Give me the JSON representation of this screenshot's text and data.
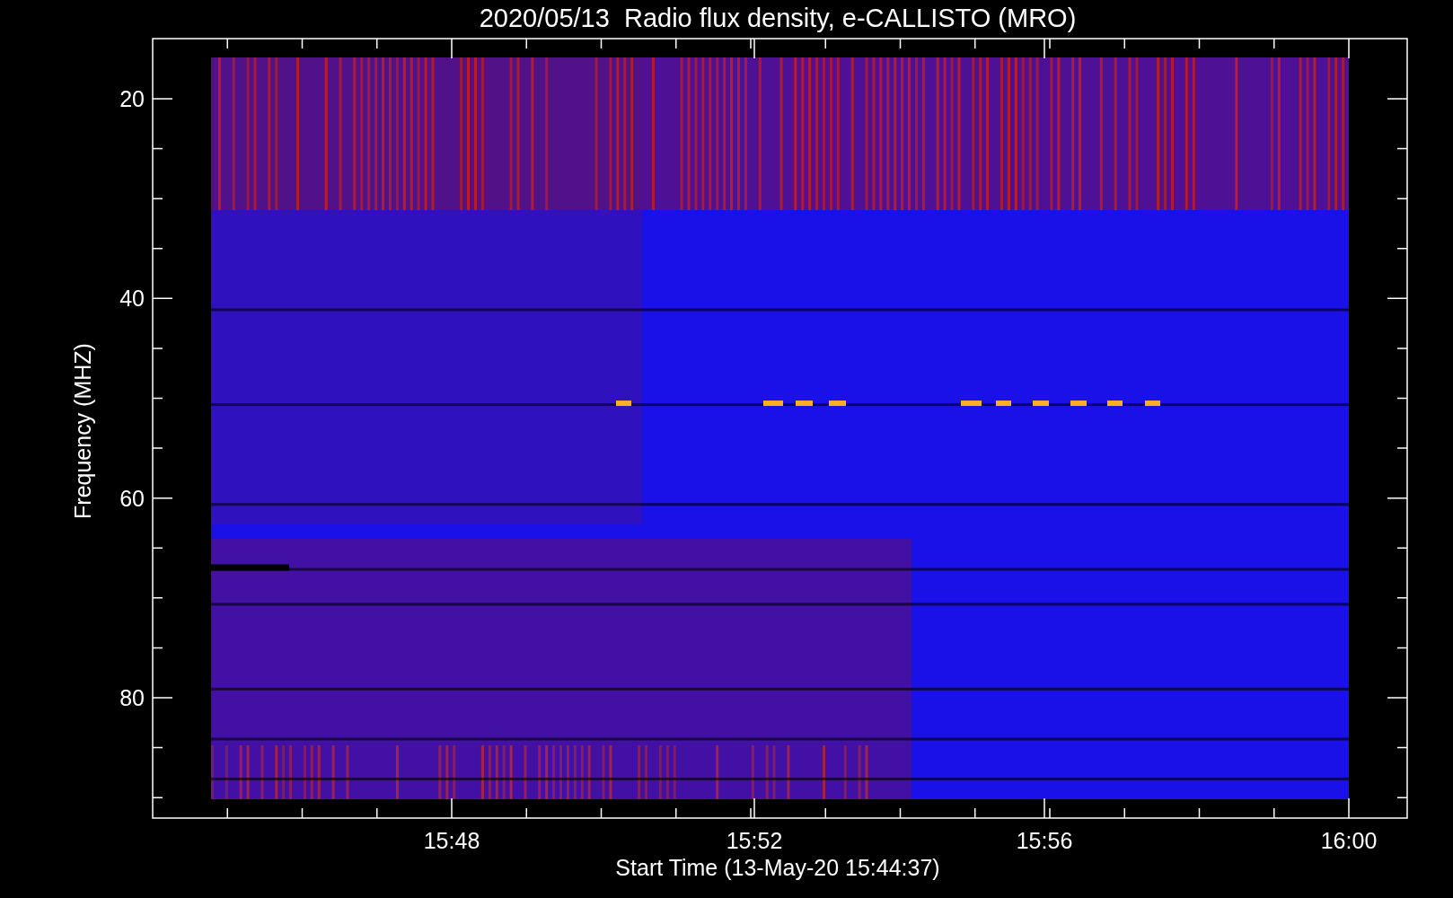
{
  "chart": {
    "title": "2020/05/13  Radio flux density, e-CALLISTO (MRO)",
    "ylabel": "Frequency (MHZ)",
    "xlabel": "Start Time (13-May-20 15:44:37)",
    "yticks": [
      "20",
      "40",
      "60",
      "80"
    ],
    "xticks": [
      "15:48",
      "15:52",
      "15:56",
      "16:00"
    ]
  }
}
